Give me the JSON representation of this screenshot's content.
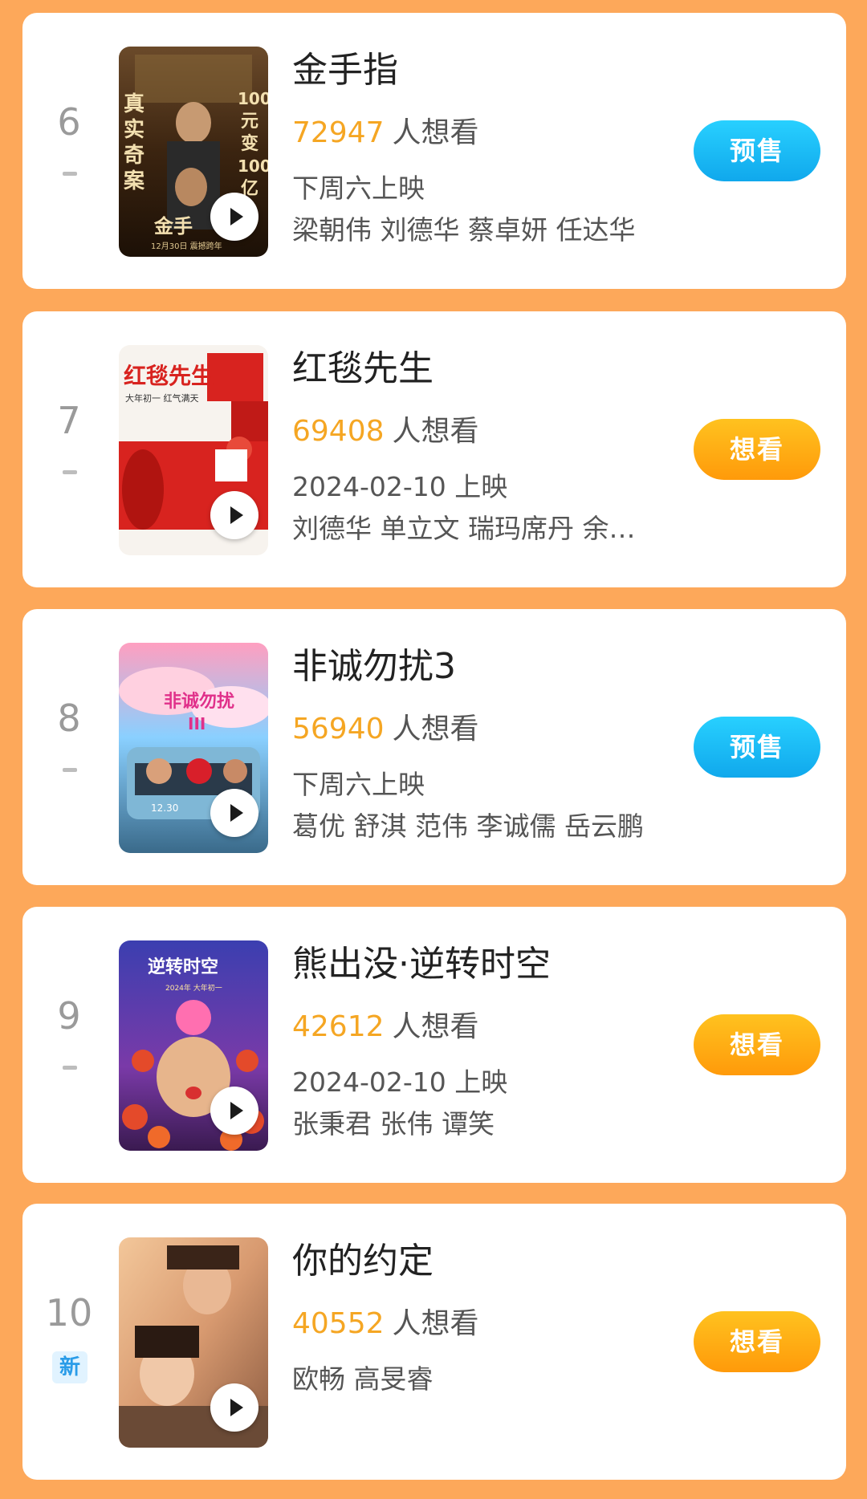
{
  "movies": [
    {
      "rank": "6",
      "badge": "",
      "title": "金手指",
      "want_count": "72947",
      "want_label": "人想看",
      "release": "下周六上映",
      "cast": "梁朝伟 刘德华 蔡卓妍 任达华",
      "button": "预售",
      "button_type": "presale",
      "poster_text": [
        "真",
        "实",
        "奇",
        "案",
        "100",
        "元",
        "变",
        "100",
        "亿",
        "金手",
        "12月30日 震撼跨年"
      ]
    },
    {
      "rank": "7",
      "badge": "",
      "title": "红毯先生",
      "want_count": "69408",
      "want_label": "人想看",
      "release": "2024-02-10 上映",
      "cast": "刘德华 单立文 瑞玛席丹 余…",
      "button": "想看",
      "button_type": "want",
      "poster_text": [
        "红毯先生",
        "大年初一 红气满天"
      ]
    },
    {
      "rank": "8",
      "badge": "",
      "title": "非诚勿扰3",
      "want_count": "56940",
      "want_label": "人想看",
      "release": "下周六上映",
      "cast": "葛优 舒淇 范伟 李诚儒 岳云鹏",
      "button": "预售",
      "button_type": "presale",
      "poster_text": [
        "非诚勿扰",
        "III",
        "12.30"
      ]
    },
    {
      "rank": "9",
      "badge": "",
      "title": "熊出没·逆转时空",
      "want_count": "42612",
      "want_label": "人想看",
      "release": "2024-02-10 上映",
      "cast": "张秉君 张伟 谭笑",
      "button": "想看",
      "button_type": "want",
      "poster_text": [
        "逆转时空",
        "2024年 大年初一"
      ]
    },
    {
      "rank": "10",
      "badge": "新",
      "title": "你的约定",
      "want_count": "40552",
      "want_label": "人想看",
      "release": "",
      "cast": "欧畅 高旻睿",
      "button": "想看",
      "button_type": "want",
      "poster_text": []
    }
  ],
  "colors": {
    "background": "#FDA85A",
    "want_count": "#F5A623",
    "presale_button": "#1AB8F5",
    "want_button": "#FFA514"
  },
  "icons": [
    "play-icon"
  ]
}
